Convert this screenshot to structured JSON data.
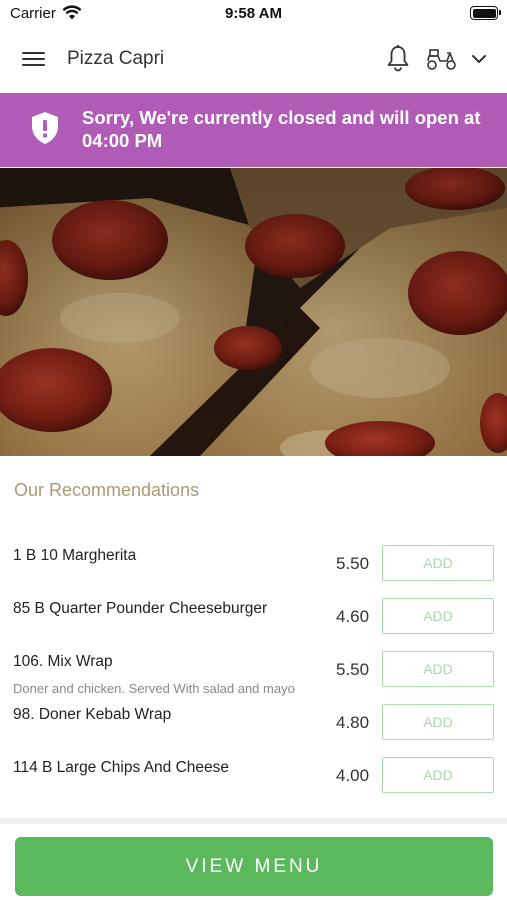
{
  "status_bar": {
    "carrier": "Carrier",
    "time": "9:58 AM"
  },
  "header": {
    "title": "Pizza Capri",
    "icons": [
      "menu-icon",
      "bell-icon",
      "scooter-icon",
      "chevron-down-icon"
    ]
  },
  "banner": {
    "message": "Sorry, We're currently closed and will open at 04:00 PM",
    "icon": "shield-alert-icon",
    "background": "#b05bb5"
  },
  "hero": {
    "subject": "pepperoni pizza"
  },
  "recommendations": {
    "heading": "Our Recommendations",
    "items": [
      {
        "name": "1 B 10 Margherita",
        "description": "",
        "price": "5.50",
        "add_label": "ADD"
      },
      {
        "name": "85 B Quarter Pounder Cheeseburger",
        "description": "",
        "price": "4.60",
        "add_label": "ADD"
      },
      {
        "name": "106. Mix Wrap",
        "description": "Doner and chicken. Served With salad and mayo",
        "price": "5.50",
        "add_label": "ADD"
      },
      {
        "name": "98. Doner Kebab Wrap",
        "description": "",
        "price": "4.80",
        "add_label": "ADD"
      },
      {
        "name": "114 B Large Chips And Cheese",
        "description": "",
        "price": "4.00",
        "add_label": "ADD"
      }
    ]
  },
  "footer": {
    "view_menu_label": "VIEW MENU",
    "accent": "#5cb85c"
  }
}
